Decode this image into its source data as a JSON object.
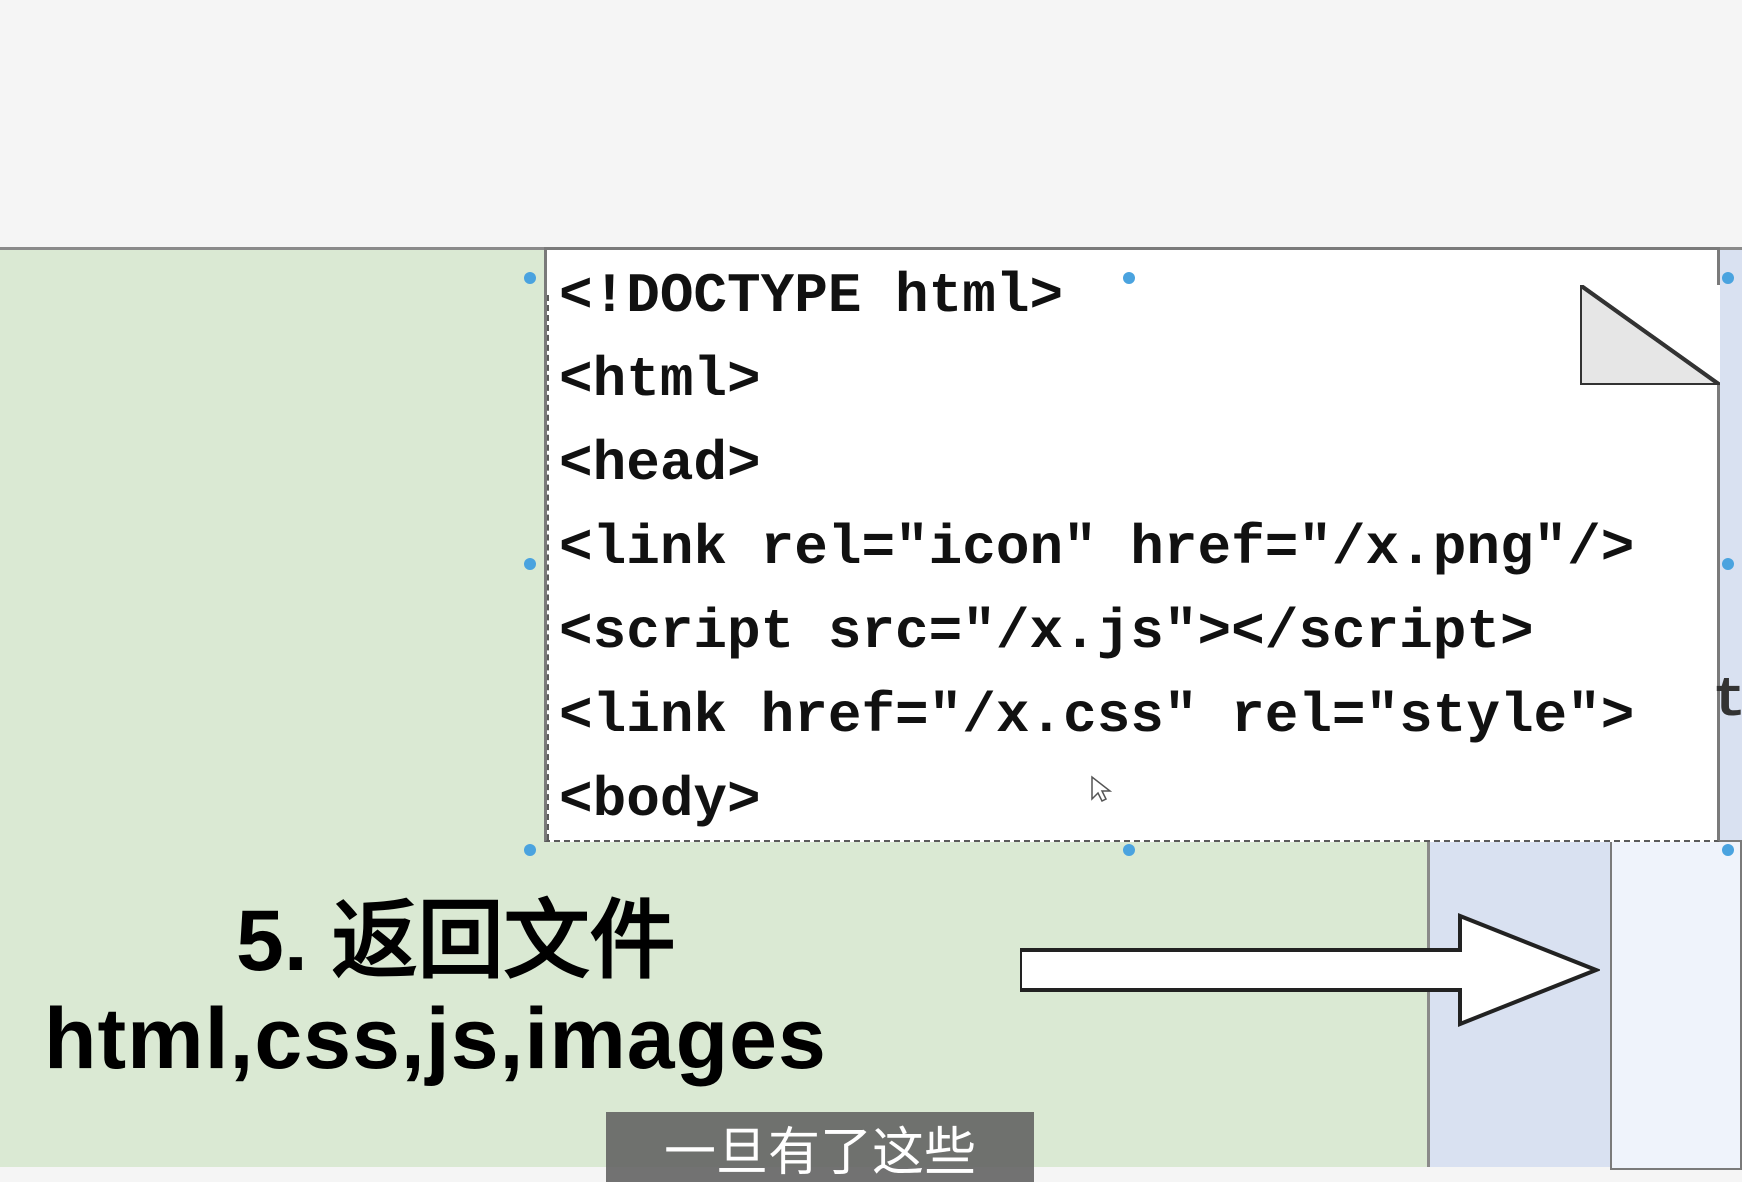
{
  "code_lines": [
    "<!DOCTYPE html>",
    "<html>",
    "<head>",
    "<link rel=\"icon\" href=\"/x.png\"/>",
    "<script src=\"/x.js\"></script>",
    "<link href=\"/x.css\" rel=\"style\">",
    "<body>"
  ],
  "label": {
    "title": "5. 返回文件",
    "subtitle": "html,css,js,images"
  },
  "subtitle_bar": "一旦有了这些",
  "peek_char": "t"
}
